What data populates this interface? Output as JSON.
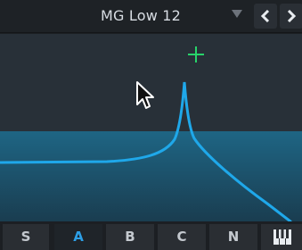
{
  "header": {
    "preset_name": "MG Low 12",
    "prev_icon": "chevron-left-icon",
    "next_icon": "chevron-right-icon",
    "dropdown_icon": "triangle-down-icon"
  },
  "display": {
    "filter_curve_color": "#1fa8ea",
    "fill_color": "#1d5f7d",
    "crosshair_color": "#28d46a",
    "crosshair_icon": "plus-icon",
    "cursor_icon": "mouse-pointer-icon"
  },
  "tabs": [
    {
      "label": "S",
      "active": false
    },
    {
      "label": "A",
      "active": true
    },
    {
      "label": "B",
      "active": false
    },
    {
      "label": "C",
      "active": false
    },
    {
      "label": "N",
      "active": false
    },
    {
      "label": "",
      "icon": "piano-keys-icon",
      "active": false
    }
  ],
  "colors": {
    "accent": "#2d9fe6",
    "background": "#1c1f23"
  }
}
